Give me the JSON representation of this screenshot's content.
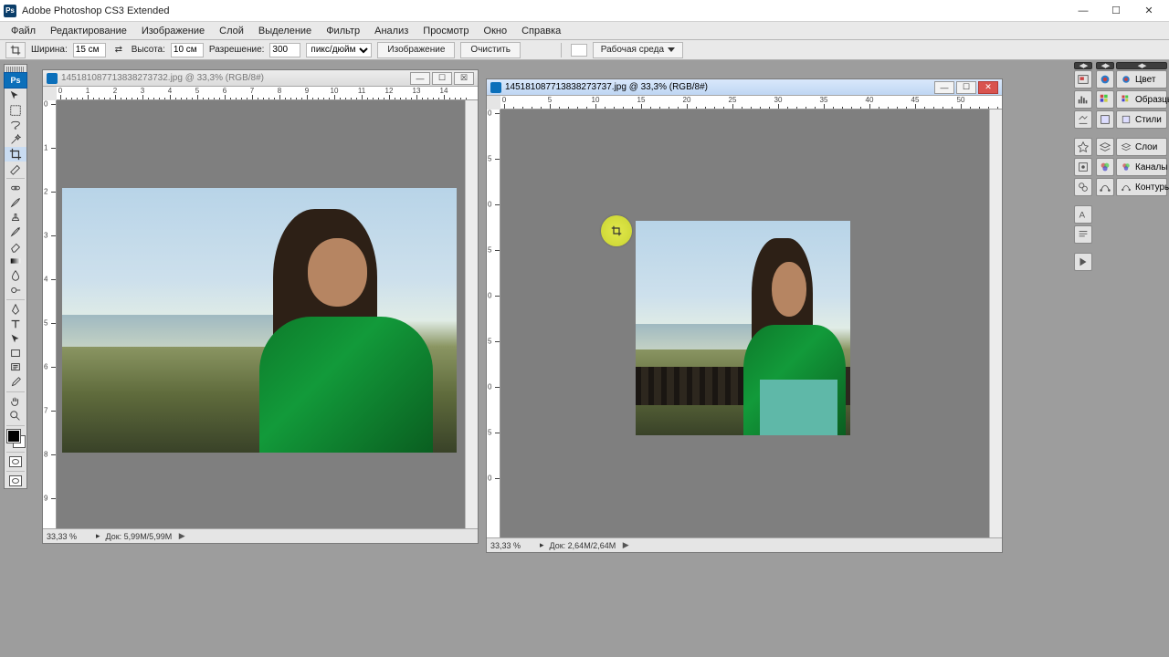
{
  "titlebar": {
    "app_title": "Adobe Photoshop CS3 Extended",
    "icon_label": "Ps"
  },
  "menu": {
    "items": [
      "Файл",
      "Редактирование",
      "Изображение",
      "Слой",
      "Выделение",
      "Фильтр",
      "Анализ",
      "Просмотр",
      "Окно",
      "Справка"
    ]
  },
  "options": {
    "width_label": "Ширина:",
    "width_value": "15 см",
    "height_label": "Высота:",
    "height_value": "10 см",
    "resolution_label": "Разрешение:",
    "resolution_value": "300",
    "units": "пикс/дюйм",
    "btn_image": "Изображение",
    "btn_clear": "Очистить",
    "workspace_label": "Рабочая среда"
  },
  "tool_names": [
    "move",
    "marquee",
    "lasso",
    "wand",
    "crop",
    "slice",
    "spot-heal",
    "brush",
    "clone",
    "history-brush",
    "eraser",
    "gradient",
    "blur",
    "dodge",
    "pen",
    "type",
    "path-select",
    "rectangle",
    "notes",
    "eyedropper",
    "hand",
    "zoom"
  ],
  "doc_left": {
    "title": "145181087713838273732.jpg @ 33,3% (RGB/8#)",
    "zoom": "33,33 %",
    "docinfo": "Док: 5,99M/5,99M",
    "ruler_h": [
      "0",
      "1",
      "2",
      "3",
      "4",
      "5",
      "6",
      "7",
      "8",
      "9",
      "10",
      "11",
      "12",
      "13",
      "14"
    ],
    "ruler_v": [
      "0",
      "1",
      "2",
      "3",
      "4",
      "5",
      "6",
      "7",
      "8",
      "9"
    ]
  },
  "doc_right": {
    "title": "145181087713838273737.jpg @ 33,3% (RGB/8#)",
    "zoom": "33,33 %",
    "docinfo": "Док: 2,64M/2,64M",
    "ruler_h": [
      "0",
      "5",
      "10",
      "15",
      "20",
      "25",
      "30",
      "35",
      "40",
      "45",
      "50"
    ],
    "ruler_v": [
      "0",
      "5",
      "0",
      "5",
      "0",
      "5",
      "0",
      "5",
      "0"
    ]
  },
  "panels": {
    "col3": [
      "Цвет",
      "Образцы",
      "Стили",
      "Слои",
      "Каналы",
      "Контуры"
    ]
  }
}
